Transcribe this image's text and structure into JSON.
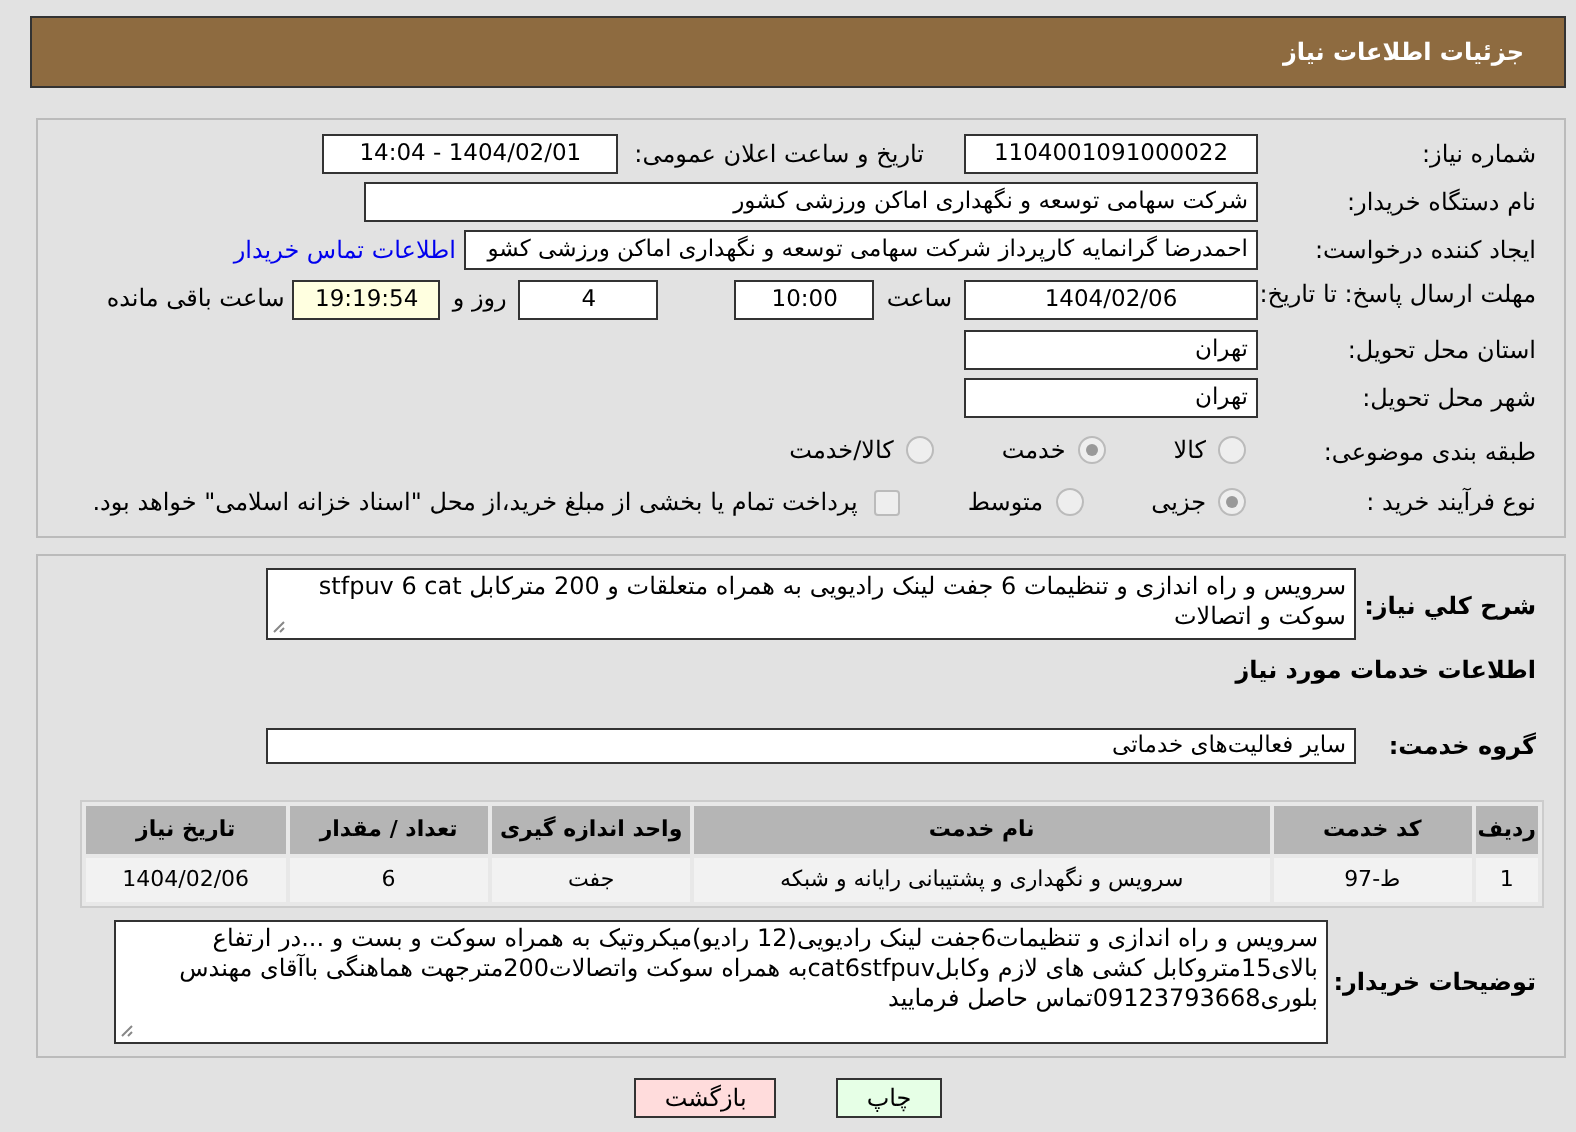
{
  "header": {
    "title": "جزئیات اطلاعات نیاز"
  },
  "need_number": {
    "label": "شماره نیاز:",
    "value": "1104001091000022"
  },
  "announce": {
    "label": "تاریخ و ساعت اعلان عمومی:",
    "value": "1404/02/01 - 14:04"
  },
  "buyer_org": {
    "label": "نام دستگاه خریدار:",
    "value": "شرکت سهامی توسعه و نگهداری اماکن ورزشی کشور"
  },
  "requester": {
    "label": "ایجاد کننده درخواست:",
    "value": "احمدرضا گرانمایه کارپرداز شرکت سهامی توسعه و نگهداری اماکن ورزشی کشو",
    "link": "اطلاعات تماس خریدار"
  },
  "deadline": {
    "label": "مهلت ارسال پاسخ: تا تاریخ:",
    "date": "1404/02/06",
    "time_label": "ساعت",
    "time": "10:00",
    "days": "4",
    "days_label": "روز و",
    "remaining": "19:19:54",
    "remaining_label": "ساعت باقی مانده"
  },
  "province": {
    "label": "استان محل تحویل:",
    "value": "تهران"
  },
  "city": {
    "label": "شهر محل تحویل:",
    "value": "تهران"
  },
  "category": {
    "label": "طبقه بندی موضوعی:",
    "options": [
      {
        "label": "کالا",
        "selected": false
      },
      {
        "label": "خدمت",
        "selected": true
      },
      {
        "label": "کالا/خدمت",
        "selected": false
      }
    ]
  },
  "process": {
    "label": "نوع فرآیند خرید :",
    "options": [
      {
        "label": "جزیی",
        "selected": true
      },
      {
        "label": "متوسط",
        "selected": false
      }
    ],
    "payment": {
      "label": "پرداخت تمام یا بخشی از مبلغ خرید،از محل \"اسناد خزانه اسلامی\" خواهد بود.",
      "checked": false
    }
  },
  "description": {
    "label": "شرح کلي نياز:",
    "value": "سرویس و راه اندازی و تنظیمات 6 جفت لینک رادیویی به همراه متعلقات و  200 مترکابل stfpuv  6  cat سوکت و اتصالات"
  },
  "services_title": "اطلاعات خدمات مورد نیاز",
  "service_group": {
    "label": "گروه خدمت:",
    "value": "سایر فعالیت‌های خدماتی"
  },
  "table": {
    "columns": [
      "ردیف",
      "کد خدمت",
      "نام خدمت",
      "واحد اندازه گیری",
      "تعداد / مقدار",
      "تاریخ نیاز"
    ],
    "rows": [
      [
        "1",
        "ط-97",
        "سرویس و نگهداری و پشتیبانی رایانه و شبکه",
        "جفت",
        "6",
        "1404/02/06"
      ]
    ]
  },
  "buyer_notes": {
    "label": "توضیحات خریدار:",
    "value": "سرویس و راه اندازی و تنظیمات6جفت لینک رادیویی(12 رادیو)میکروتیک به همراه سوکت و بست و ...در ارتفاع بالای15متروکابل کشی های لازم وکابلcat6stfpuvبه همراه سوکت واتصالات200مترجهت هماهنگی باآقای مهندس بلوری09123793668تماس حاصل فرمایید"
  },
  "buttons": [
    {
      "label": "چاپ",
      "kind": "print"
    },
    {
      "label": "بازگشت",
      "kind": "back"
    }
  ]
}
